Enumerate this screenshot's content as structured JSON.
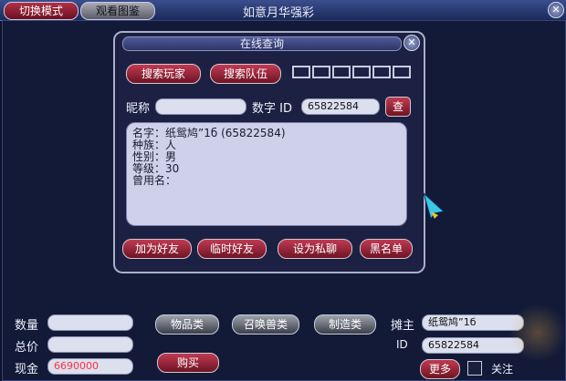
{
  "topbar": {
    "switch_mode": "切换模式",
    "view_catalog": "观看图鉴",
    "title": "如意月华强彩"
  },
  "dialog": {
    "title": "在线查询",
    "search_player": "搜索玩家",
    "search_team": "搜索队伍",
    "nickname_label": "昵称",
    "nickname_value": "",
    "number_id_label": "数字 ID",
    "number_id_value": "65822584",
    "query_button": "查",
    "info": {
      "line1": "名字：纸鸳鸠”1б (65822584)",
      "line2": "种族：人",
      "line3": "性别：男",
      "line4": "等级：30",
      "line5": "曾用名："
    },
    "actions": [
      "加为好友",
      "临时好友",
      "设为私聊",
      "黑名单"
    ]
  },
  "bottom": {
    "quantity_label": "数量",
    "total_label": "总价",
    "cash_label": "现金",
    "cash_value": "6690000",
    "item_types": [
      "物品类",
      "召唤兽类",
      "制造类"
    ],
    "buy": "购买",
    "stall_owner_label": "摊主",
    "stall_owner_value": "纸鸳鸠”1б",
    "id_label": "ID",
    "id_value": "65822584",
    "more": "更多",
    "follow": "关注"
  },
  "colors": {
    "accent_red": "#b03048",
    "cash_value": "#ff3040",
    "panel": "#1c2143"
  }
}
